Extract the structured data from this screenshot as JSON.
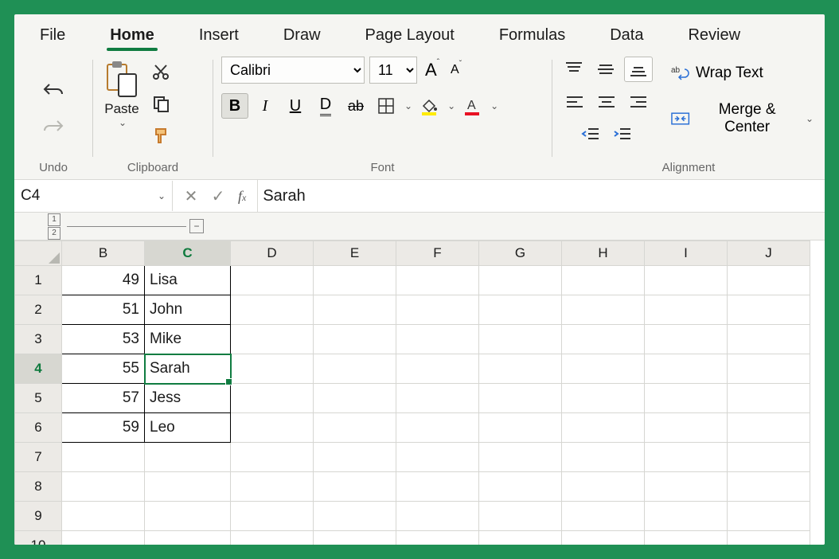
{
  "tabs": [
    "File",
    "Home",
    "Insert",
    "Draw",
    "Page Layout",
    "Formulas",
    "Data",
    "Review"
  ],
  "active_tab": "Home",
  "ribbon": {
    "undo_label": "Undo",
    "clipboard_label": "Clipboard",
    "paste_label": "Paste",
    "font_label": "Font",
    "alignment_label": "Alignment",
    "font_name": "Calibri",
    "font_size": "11",
    "wrap_text": "Wrap Text",
    "merge_center": "Merge & Center"
  },
  "namebox": "C4",
  "formula_value": "Sarah",
  "outline_levels": [
    "1",
    "2"
  ],
  "columns": [
    "B",
    "C",
    "D",
    "E",
    "F",
    "G",
    "H",
    "I",
    "J"
  ],
  "active_col": "C",
  "active_row": 4,
  "visible_rows": [
    1,
    2,
    3,
    4,
    5,
    6,
    7,
    8,
    9,
    10
  ],
  "cells": {
    "B1": 49,
    "C1": "Lisa",
    "B2": 51,
    "C2": "John",
    "B3": 53,
    "C3": "Mike",
    "B4": 55,
    "C4": "Sarah",
    "B5": 57,
    "C5": "Jess",
    "B6": 59,
    "C6": "Leo"
  },
  "selected_cell": "C4"
}
